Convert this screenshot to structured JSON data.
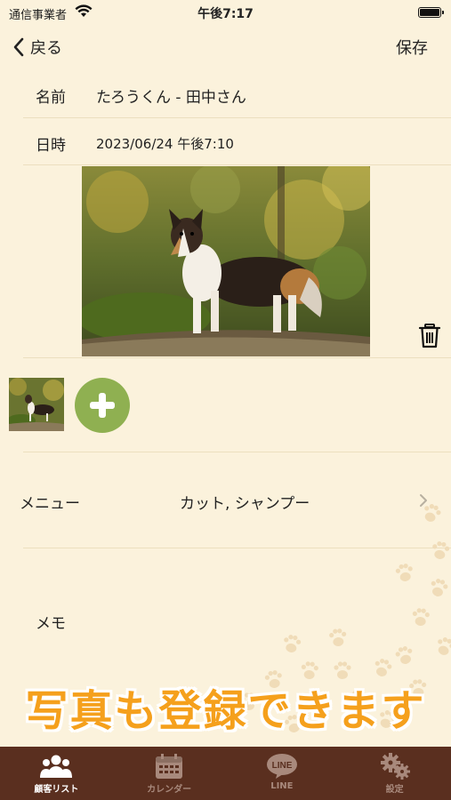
{
  "status": {
    "carrier": "通信事業者",
    "time": "午後7:17"
  },
  "nav": {
    "back_label": "戻る",
    "save_label": "保存"
  },
  "form": {
    "name_label": "名前",
    "name_value": "たろうくん - 田中さん",
    "datetime_label": "日時",
    "datetime_value": "2023/06/24 午後7:10",
    "menu_label": "メニュー",
    "menu_value": "カット, シャンプー",
    "memo_label": "メモ"
  },
  "banner": {
    "text": "写真も登録できます"
  },
  "tabs": [
    {
      "label": "顧客リスト",
      "icon": "people-icon",
      "active": true
    },
    {
      "label": "カレンダー",
      "icon": "calendar-icon",
      "active": false
    },
    {
      "label": "LINE",
      "icon": "line-icon",
      "active": false
    },
    {
      "label": "設定",
      "icon": "gear-icon",
      "active": false
    }
  ],
  "colors": {
    "background": "#fbf2dc",
    "accent_orange": "#f5a01c",
    "add_green": "#8fb051",
    "tabbar": "#5a2f1f"
  }
}
